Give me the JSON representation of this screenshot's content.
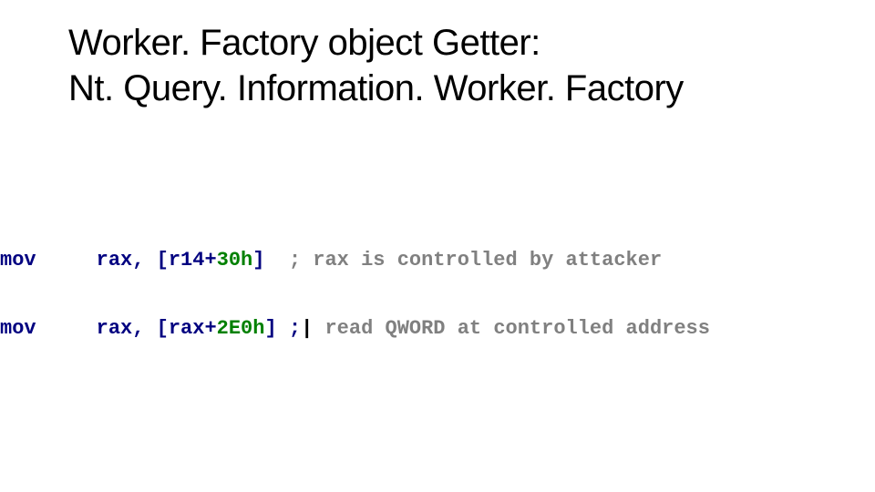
{
  "title": {
    "line1": "Worker. Factory object Getter:",
    "line2": "Nt. Query. Information. Worker. Factory"
  },
  "disasm": {
    "lines": [
      {
        "mnemonic": "mov",
        "op_left": "rax, [r14+",
        "imm": "30h",
        "op_right": "]",
        "gap": "  ",
        "comment": "; rax is controlled by attacker"
      },
      {
        "mnemonic": "mov",
        "op_left": "rax, [rax+",
        "imm": "2E0h",
        "op_right": "] ;",
        "gap": "",
        "cursor": "|",
        "comment_after": " read QWORD at controlled address"
      }
    ]
  }
}
